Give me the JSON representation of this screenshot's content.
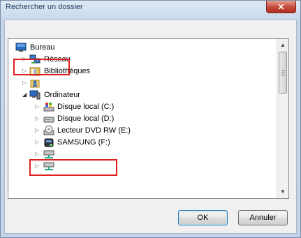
{
  "window": {
    "title": "Rechercher un dossier",
    "close_label": "✕"
  },
  "tree": {
    "items": [
      {
        "label": "Bureau",
        "icon": "desktop-icon"
      },
      {
        "label": "Réseau",
        "icon": "network-icon"
      },
      {
        "label": "Bibliothèques",
        "icon": "libraries-icon"
      },
      {
        "label": "",
        "icon": "user-folder-icon"
      },
      {
        "label": "Ordinateur",
        "icon": "computer-icon"
      },
      {
        "label": "Disque local (C:)",
        "icon": "windows-drive-icon"
      },
      {
        "label": "Disque local (D:)",
        "icon": "hard-drive-icon"
      },
      {
        "label": "Lecteur DVD RW (E:)",
        "icon": "dvd-drive-icon"
      },
      {
        "label": "SAMSUNG (F:)",
        "icon": "usb-drive-icon"
      },
      {
        "label": "",
        "icon": "network-drive-icon"
      },
      {
        "label": "",
        "icon": "network-drive-icon"
      }
    ]
  },
  "buttons": {
    "ok": "OK",
    "cancel": "Annuler"
  },
  "highlight_color": "#e02020"
}
